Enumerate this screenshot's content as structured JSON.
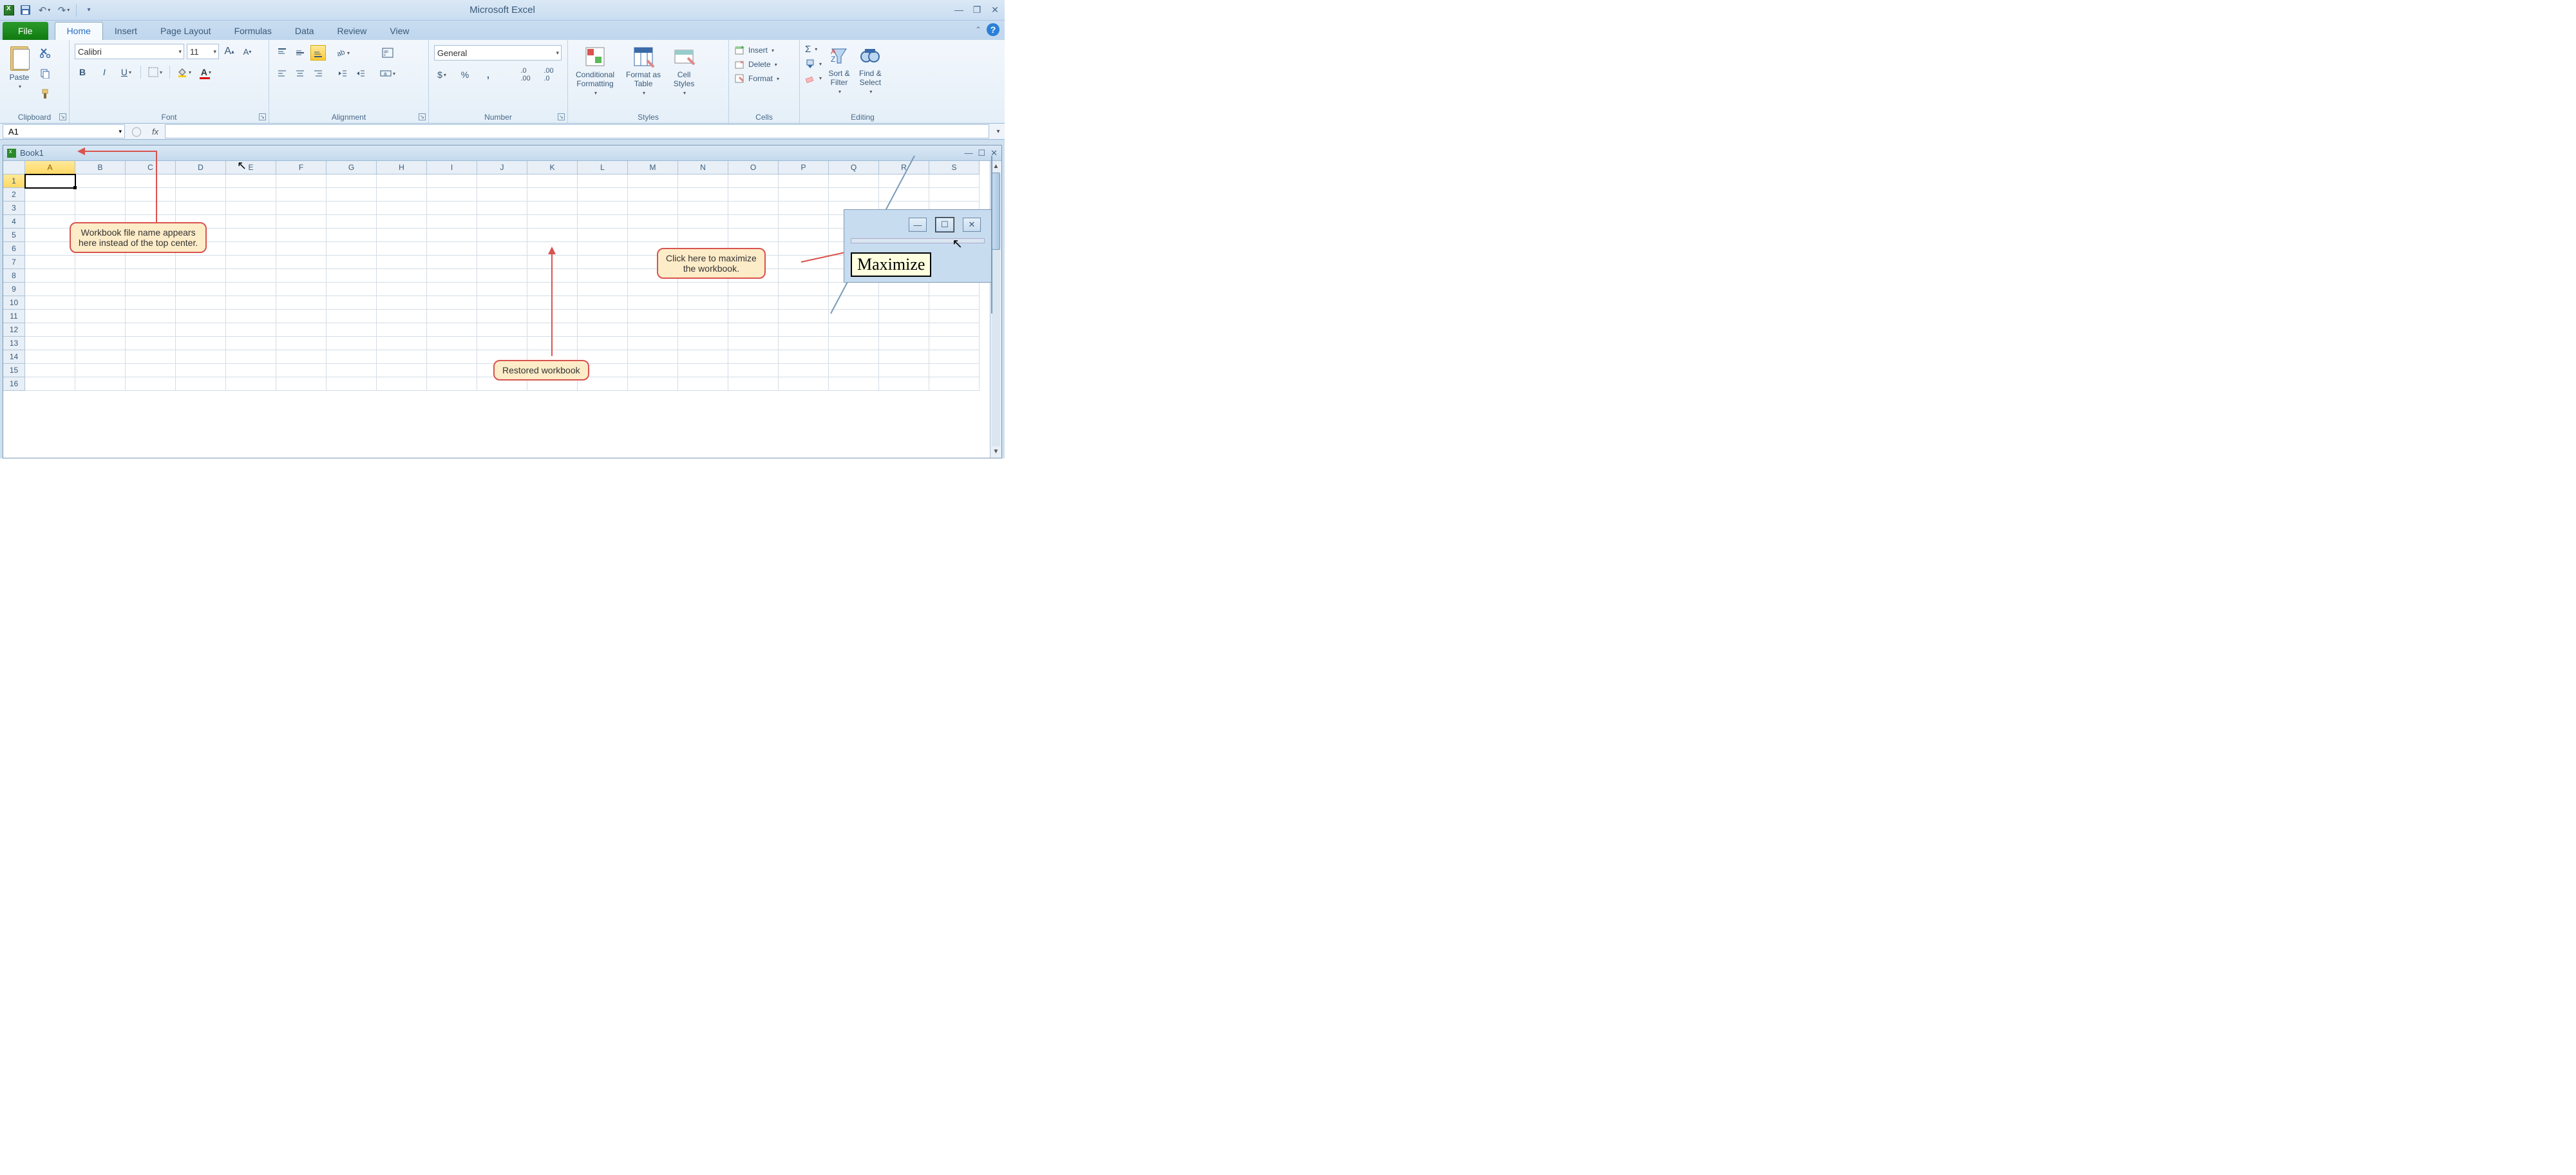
{
  "app": {
    "title": "Microsoft Excel"
  },
  "qat": {
    "save": "💾",
    "undo": "↶",
    "redo": "↷"
  },
  "tabs": {
    "file": "File",
    "items": [
      "Home",
      "Insert",
      "Page Layout",
      "Formulas",
      "Data",
      "Review",
      "View"
    ],
    "active": 0
  },
  "ribbon": {
    "clipboard": {
      "label": "Clipboard",
      "paste": "Paste"
    },
    "font": {
      "label": "Font",
      "name": "Calibri",
      "size": "11"
    },
    "alignment": {
      "label": "Alignment"
    },
    "number": {
      "label": "Number",
      "format": "General"
    },
    "styles": {
      "label": "Styles",
      "cond": "Conditional\nFormatting",
      "table": "Format as\nTable",
      "cell": "Cell\nStyles"
    },
    "cells": {
      "label": "Cells",
      "insert": "Insert",
      "delete": "Delete",
      "format": "Format"
    },
    "editing": {
      "label": "Editing",
      "sort": "Sort &\nFilter",
      "find": "Find &\nSelect"
    }
  },
  "fxbar": {
    "namebox": "A1",
    "fx": "fx"
  },
  "workbook": {
    "name": "Book1",
    "columns": [
      "A",
      "B",
      "C",
      "D",
      "E",
      "F",
      "G",
      "H",
      "I",
      "J",
      "K",
      "L",
      "M",
      "N",
      "O",
      "P",
      "Q",
      "R",
      "S"
    ],
    "rows": [
      1,
      2,
      3,
      4,
      5,
      6,
      7,
      8,
      9,
      10,
      11,
      12,
      13,
      14,
      15,
      16
    ],
    "activeCell": "A1"
  },
  "callouts": {
    "filename": "Workbook file name appears\nhere instead of the top center.",
    "restored": "Restored workbook",
    "maximize": "Click here to maximize\nthe workbook."
  },
  "inset": {
    "tooltip": "Maximize"
  }
}
